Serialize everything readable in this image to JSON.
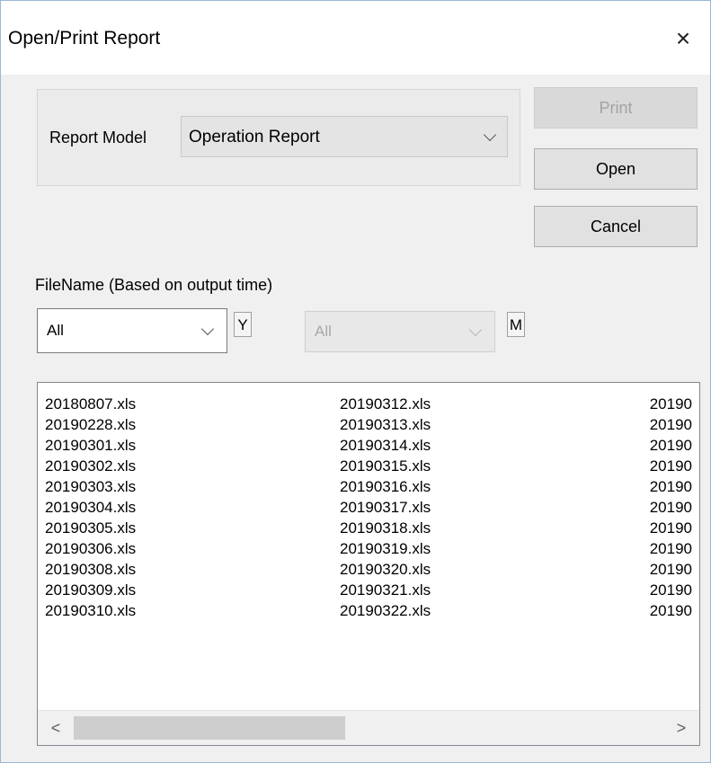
{
  "window": {
    "title": "Open/Print Report",
    "close_symbol": "×"
  },
  "report_model": {
    "label": "Report Model",
    "selected": "Operation Report"
  },
  "buttons": {
    "print": "Print",
    "open": "Open",
    "cancel": "Cancel"
  },
  "filter": {
    "label": "FileName (Based on output time)",
    "year_value": "All",
    "year_unit": "Y",
    "month_value": "All",
    "month_unit": "M"
  },
  "files": {
    "column1": [
      "20180807.xls",
      "20190228.xls",
      "20190301.xls",
      "20190302.xls",
      "20190303.xls",
      "20190304.xls",
      "20190305.xls",
      "20190306.xls",
      "20190308.xls",
      "20190309.xls",
      "20190310.xls"
    ],
    "column2": [
      "20190312.xls",
      "20190313.xls",
      "20190314.xls",
      "20190315.xls",
      "20190316.xls",
      "20190317.xls",
      "20190318.xls",
      "20190319.xls",
      "20190320.xls",
      "20190321.xls",
      "20190322.xls"
    ],
    "column3": [
      "20190",
      "20190",
      "20190",
      "20190",
      "20190",
      "20190",
      "20190",
      "20190",
      "20190",
      "20190",
      "20190"
    ]
  },
  "scrollbar": {
    "left_arrow": "<",
    "right_arrow": ">"
  }
}
